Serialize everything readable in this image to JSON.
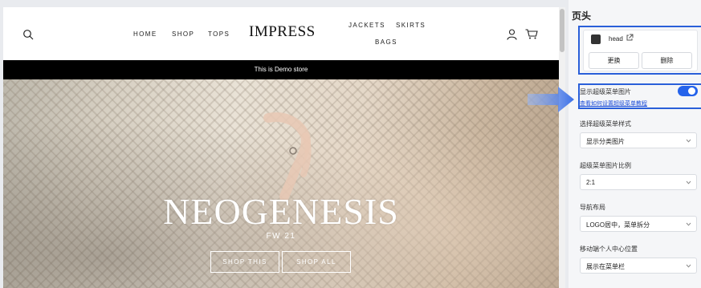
{
  "store": {
    "logo": "IMPRESS",
    "nav_left": [
      "HOME",
      "SHOP",
      "TOPS"
    ],
    "nav_right": [
      "JACKETS",
      "SKIRTS",
      "BAGS"
    ],
    "announcement": "This is Demo store",
    "hero": {
      "title": "NEOGENESIS",
      "subtitle": "FW 21",
      "btn_shop_this": "SHOP THIS",
      "btn_shop_all": "SHOP ALL"
    }
  },
  "panel": {
    "title": "页头",
    "logo_file": "head",
    "btn_replace": "更换",
    "btn_delete": "删除",
    "toggle_label": "显示超级菜单图片",
    "toggle_on": true,
    "help_link": "查看如何设置超级菜单教程",
    "fields": [
      {
        "label": "选择超级菜单样式",
        "value": "显示分类图片"
      },
      {
        "label": "超级菜单图片比例",
        "value": "2:1"
      },
      {
        "label": "导航布局",
        "value": "LOGO居中，菜单拆分"
      },
      {
        "label": "移动端个人中心位置",
        "value": "展示在菜单栏"
      }
    ]
  },
  "colors": {
    "accent": "#2563eb",
    "highlight_border": "#2a5fd9",
    "announcement_bg": "#000000"
  }
}
